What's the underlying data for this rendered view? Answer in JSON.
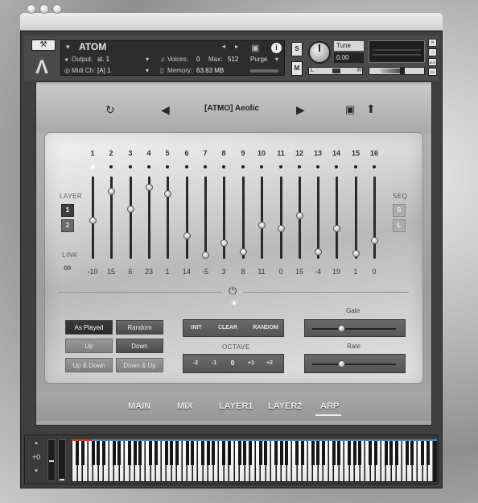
{
  "header": {
    "instrument_name": "ATOM",
    "output_label": "Output:",
    "output_value": "st. 1",
    "voices_label": "Voices:",
    "voices_value": "0",
    "max_label": "Max:",
    "max_value": "512",
    "midi_label": "Midi Ch:",
    "midi_value": "[A] 1",
    "memory_label": "Memory:",
    "memory_value": "63.83 MB",
    "purge_label": "Purge",
    "s_button": "S",
    "m_button": "M",
    "tune_label": "Tune",
    "tune_value": "0.00",
    "pan_left": "L",
    "pan_right": "R",
    "aux_label": "AUX",
    "pv_label": "PV"
  },
  "preset": {
    "name": "[ATMO] Aeolic"
  },
  "steps": {
    "numbers": [
      "1",
      "2",
      "3",
      "4",
      "5",
      "6",
      "7",
      "8",
      "9",
      "10",
      "11",
      "12",
      "13",
      "14",
      "15",
      "16"
    ],
    "values": [
      "-10",
      "15",
      "6",
      "23",
      "1",
      "14",
      "-5",
      "3",
      "8",
      "11",
      "0",
      "15",
      "-4",
      "19",
      "1",
      "0"
    ]
  },
  "layer": {
    "label": "LAYER",
    "btn1": "1",
    "btn2": "2",
    "link_label": "LINK"
  },
  "seq": {
    "label": "SEQ",
    "btn1": "S",
    "btn2": "L"
  },
  "modes": {
    "as_played": "As Played",
    "random": "Random",
    "up": "Up",
    "down": "Down",
    "up_down": "Up & Down",
    "down_up": "Down & Up"
  },
  "controls": {
    "init": "INIT",
    "clear": "CLEAR",
    "random": "RANDOM",
    "octave_label": "OCTAVE",
    "octave_values": [
      "-2",
      "-1",
      "0",
      "+1",
      "+2"
    ],
    "gate_label": "Gate",
    "rate_label": "Rate"
  },
  "tabs": [
    "MAIN",
    "MIX",
    "LAYER1",
    "LAYER2",
    "ARP"
  ],
  "keyboard": {
    "transpose": "+0"
  },
  "colors": {
    "keyboard_range_red": "#d03a3a",
    "keyboard_range_blue": "#4a8ab8"
  }
}
